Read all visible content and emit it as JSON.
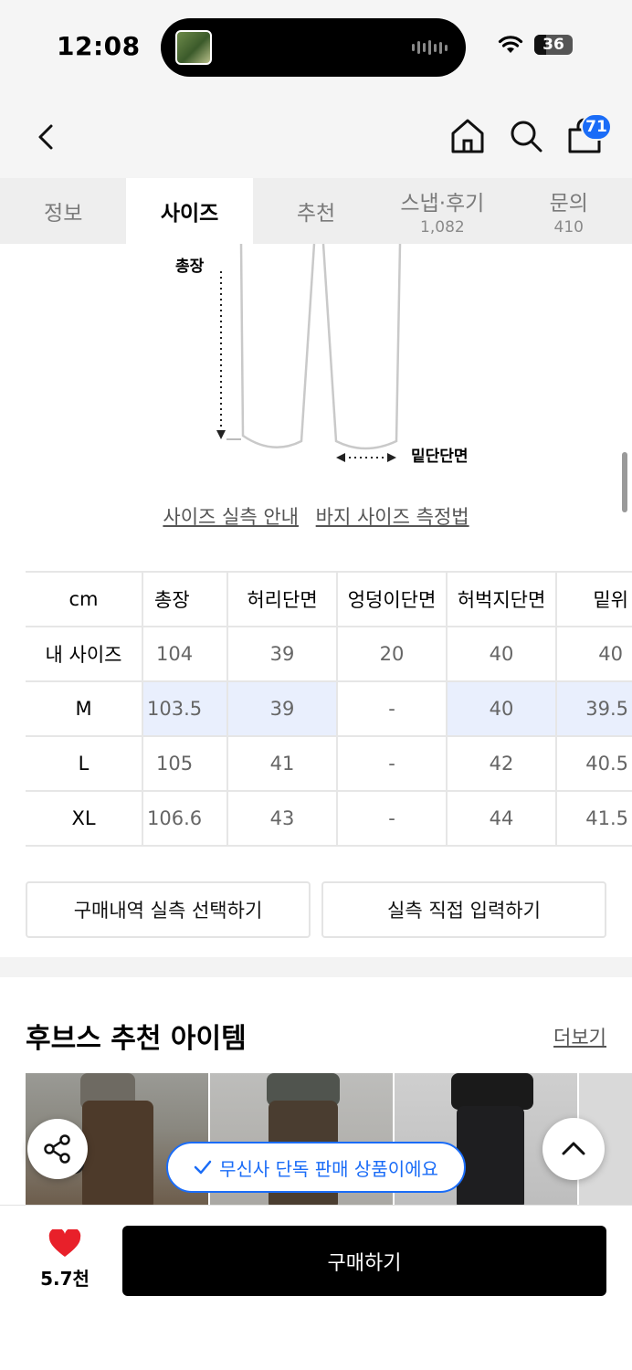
{
  "status_bar": {
    "time": "12:08",
    "battery": "36"
  },
  "header": {
    "cart_count": "71"
  },
  "tabs": [
    {
      "label": "정보",
      "sub": ""
    },
    {
      "label": "사이즈",
      "sub": ""
    },
    {
      "label": "추천",
      "sub": ""
    },
    {
      "label": "스냅·후기",
      "sub": "1,082"
    },
    {
      "label": "문의",
      "sub": "410"
    }
  ],
  "active_tab": "사이즈",
  "illustration": {
    "total_length_label": "총장",
    "hem_label": "밑단단면"
  },
  "guide_links": {
    "measure_guide": "사이즈 실측 안내",
    "pants_method": "바지 사이즈 측정법"
  },
  "size_table": {
    "headers": [
      "cm",
      "총장",
      "허리단면",
      "엉덩이단면",
      "허벅지단면",
      "밑위"
    ],
    "rows": [
      {
        "label": "내 사이즈",
        "values": [
          "104",
          "39",
          "20",
          "40",
          "40"
        ]
      },
      {
        "label": "M",
        "values": [
          "103.5",
          "39",
          "-",
          "40",
          "39.5"
        ]
      },
      {
        "label": "L",
        "values": [
          "105",
          "41",
          "-",
          "42",
          "40.5"
        ]
      },
      {
        "label": "XL",
        "values": [
          "106.6",
          "43",
          "-",
          "44",
          "41.5"
        ]
      }
    ]
  },
  "actions": {
    "select_purchase": "구매내역 실측 선택하기",
    "manual_input": "실측 직접 입력하기"
  },
  "recommend": {
    "title": "후브스 추천 아이템",
    "more": "더보기"
  },
  "exclusive_badge": "무신사 단독 판매 상품이에요",
  "bottom": {
    "like_count": "5.7천",
    "buy_label": "구매하기"
  },
  "colors": {
    "accent": "#1a6cf7",
    "highlight": "#e9effd",
    "like": "#e8202a"
  }
}
